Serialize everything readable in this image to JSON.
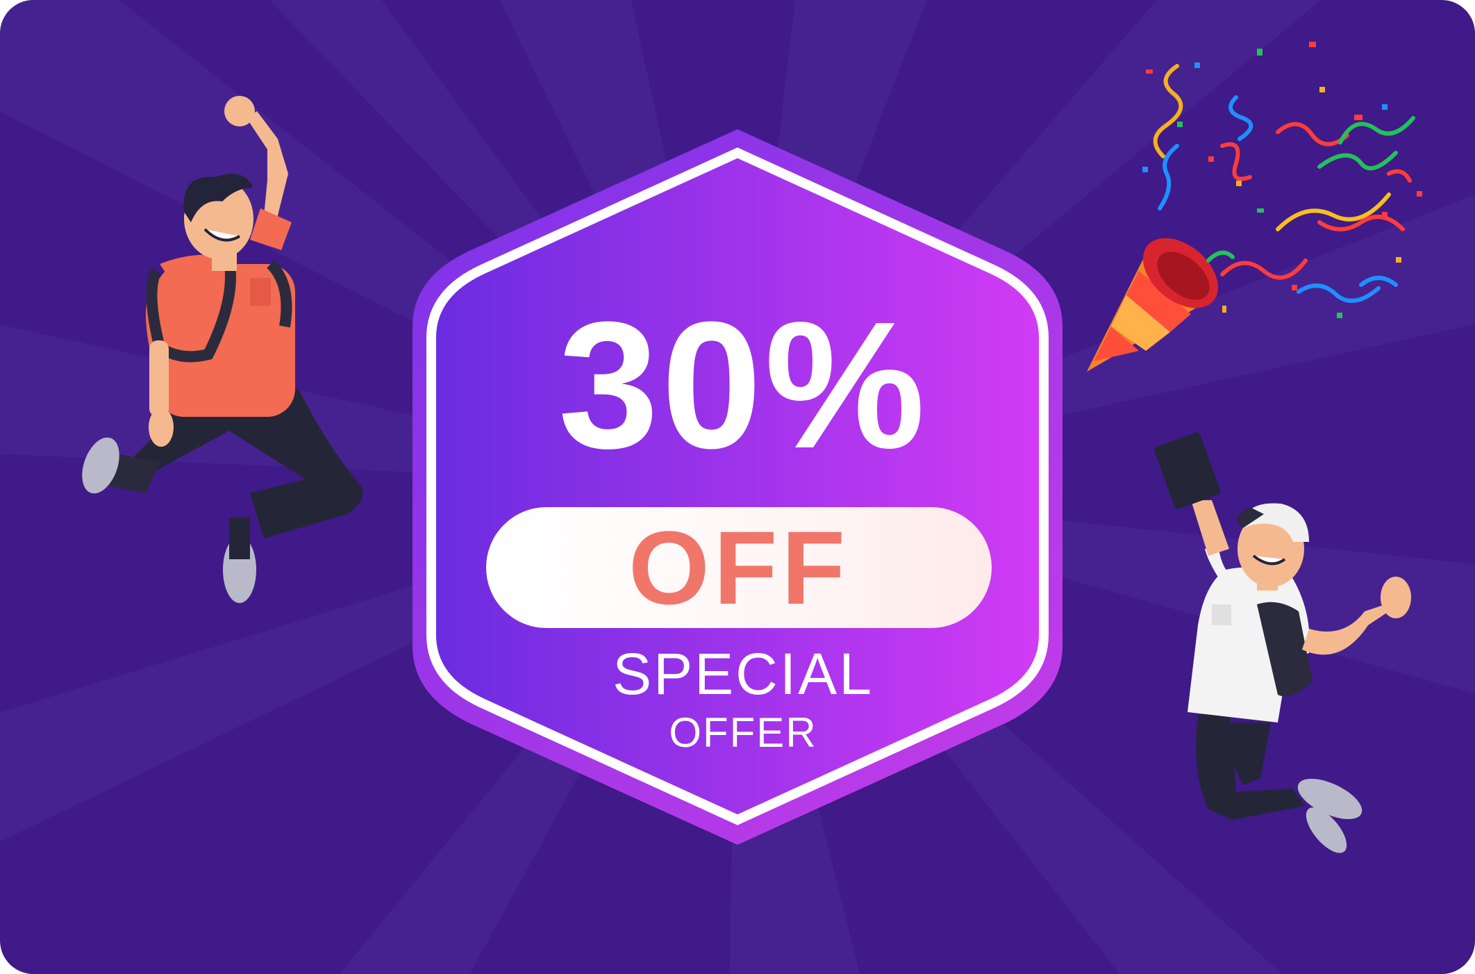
{
  "badge": {
    "discount": "30%",
    "off_label": "OFF",
    "special_label": "SPECIAL",
    "offer_label": "OFFER"
  },
  "colors": {
    "background": "#3f1a88",
    "badge_gradient_start": "#6a2ce0",
    "badge_gradient_end": "#d23bf5",
    "off_text": "#f1766a",
    "text": "#ffffff"
  },
  "illustrations": {
    "left": "jumping-student-orange-shirt",
    "right": "jumping-student-white-shirt-with-book",
    "top_right": "party-popper-confetti"
  }
}
